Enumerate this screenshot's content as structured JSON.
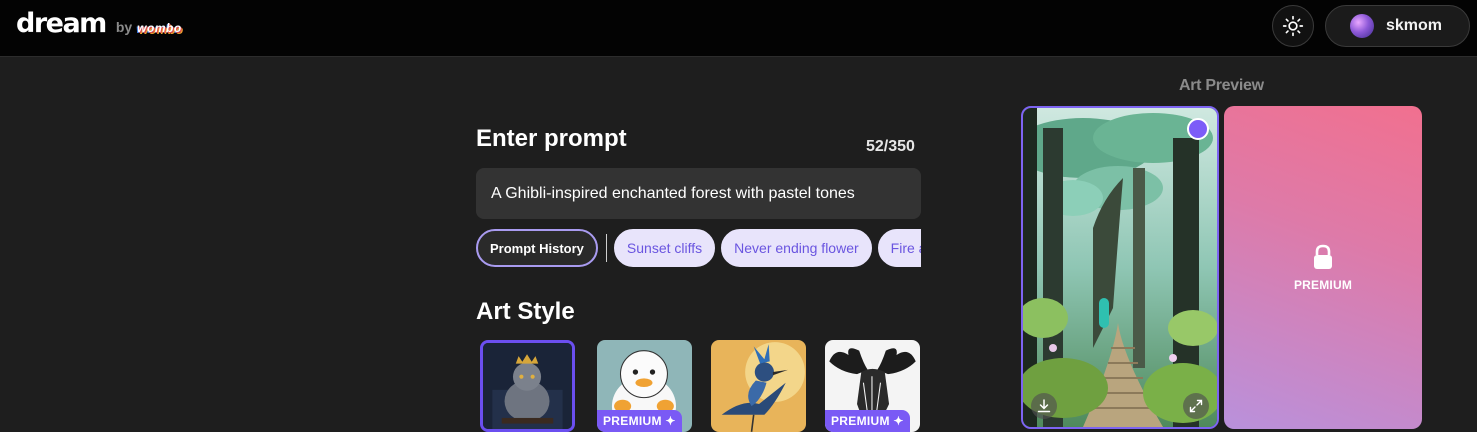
{
  "header": {
    "logo_text": "dream",
    "by_text": "by",
    "brand_text": "wombo",
    "user_name": "skmom"
  },
  "prompt": {
    "title": "Enter prompt",
    "char_count": "52/350",
    "value": "A Ghibli-inspired enchanted forest with pastel tones",
    "history_label": "Prompt History",
    "suggestions": [
      "Sunset cliffs",
      "Never ending flower",
      "Fire and w"
    ]
  },
  "art_style": {
    "title": "Art Style",
    "premium_badge": "PREMIUM",
    "premium_star": "✦",
    "styles": [
      {
        "thumb": "cat-king",
        "premium": false,
        "selected": true
      },
      {
        "thumb": "duck-cartoon",
        "premium": true,
        "selected": false
      },
      {
        "thumb": "blue-bird",
        "premium": false,
        "selected": false
      },
      {
        "thumb": "moose-ink",
        "premium": true,
        "selected": false
      }
    ]
  },
  "preview": {
    "title": "Art Preview",
    "premium_label": "PREMIUM"
  },
  "colors": {
    "accent": "#7c5cf8",
    "chip_bg": "#e8e4fb",
    "chip_text": "#6a55e0",
    "background": "#1e1e1e",
    "header_bg": "#030303"
  }
}
